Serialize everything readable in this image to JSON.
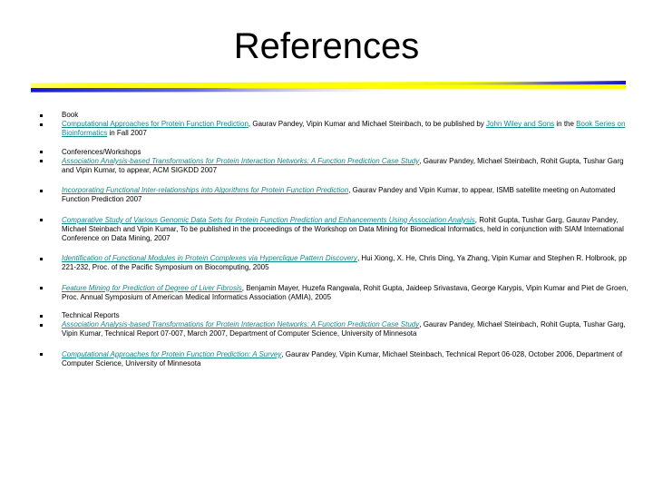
{
  "slide": {
    "title": "References",
    "divider": {
      "color_yellow": "#FFFF00",
      "color_blue": "#2222CC"
    },
    "link_color": "#0F8A8A",
    "sections": [
      {
        "heading": "Book",
        "entries": [
          {
            "link": "Computational Approaches for Protein Function Prediction",
            "link_style": "normal",
            "rest_a": ", Gaurav Pandey, Vipin Kumar and Michael Steinbach, to be published by ",
            "link2": "John Wiley and Sons",
            "rest_b": " in the ",
            "link3": "Book Series on Bioinformatics",
            "rest_c": " in Fall 2007"
          }
        ]
      },
      {
        "heading": "Conferences/Workshops",
        "entries": [
          {
            "link": "Association Analysis-based Transformations for Protein Interaction Networks: A Function Prediction Case Study",
            "link_style": "italic",
            "rest_a": ", Gaurav Pandey, Michael Steinbach, Rohit Gupta, Tushar Garg and Vipin Kumar, to appear, ACM SIGKDD 2007"
          },
          {
            "link": "Incorporating Functional Inter-relationships into Algorithms for Protein Function Prediction",
            "link_style": "italic",
            "rest_a": ", Gaurav Pandey and Vipin Kumar, to appear, ISMB satellite meeting on Automated Function Prediction 2007"
          },
          {
            "link": "Comparative Study of Various Genomic Data Sets for Protein Function Prediction and Enhancements Using Association Analysis",
            "link_style": "italic",
            "rest_a": ", Rohit Gupta, Tushar Garg, Gaurav Pandey, Michael Steinbach and Vipin Kumar, To be published in the proceedings of the Workshop on Data Mining for Biomedical Informatics, held in conjunction with SIAM International Conference on Data Mining, 2007"
          },
          {
            "link": "Identification of Functional Modules in Protein Complexes via Hyperclique Pattern Discovery",
            "link_style": "italic",
            "rest_a": ", Hui Xiong, X. He, Chris Ding, Ya Zhang, Vipin Kumar and Stephen R. Holbrook, pp 221-232, Proc. of the Pacific Symposium on Biocomputing, 2005"
          },
          {
            "link": "Feature Mining for Prediction of Degree of Liver Fibrosis",
            "link_style": "italic",
            "rest_a": ", Benjamin Mayer, Huzefa Rangwala, Rohit Gupta, Jaideep Srivastava, George Karypis, Vipin Kumar and Piet de Groen, Proc. Annual Symposium of American Medical Informatics Association (AMIA), 2005"
          }
        ]
      },
      {
        "heading": "Technical Reports",
        "entries": [
          {
            "link": "Association Analysis-based Transformations for Protein Interaction Networks: A Function Prediction Case Study",
            "link_style": "italic",
            "rest_a": ", Gaurav Pandey, Michael Steinbach, Rohit Gupta, Tushar Garg, Vipin Kumar, Technical Report 07-007, March 2007, Department of Computer Science, University of Minnesota"
          },
          {
            "link": "Computational Approaches for Protein Function Prediction: A Survey",
            "link_style": "italic",
            "rest_a": ", Gaurav Pandey, Vipin Kumar, Michael Steinbach, Technical Report 06-028, October 2006, Department of Computer Science, University of Minnesota"
          }
        ]
      }
    ]
  }
}
